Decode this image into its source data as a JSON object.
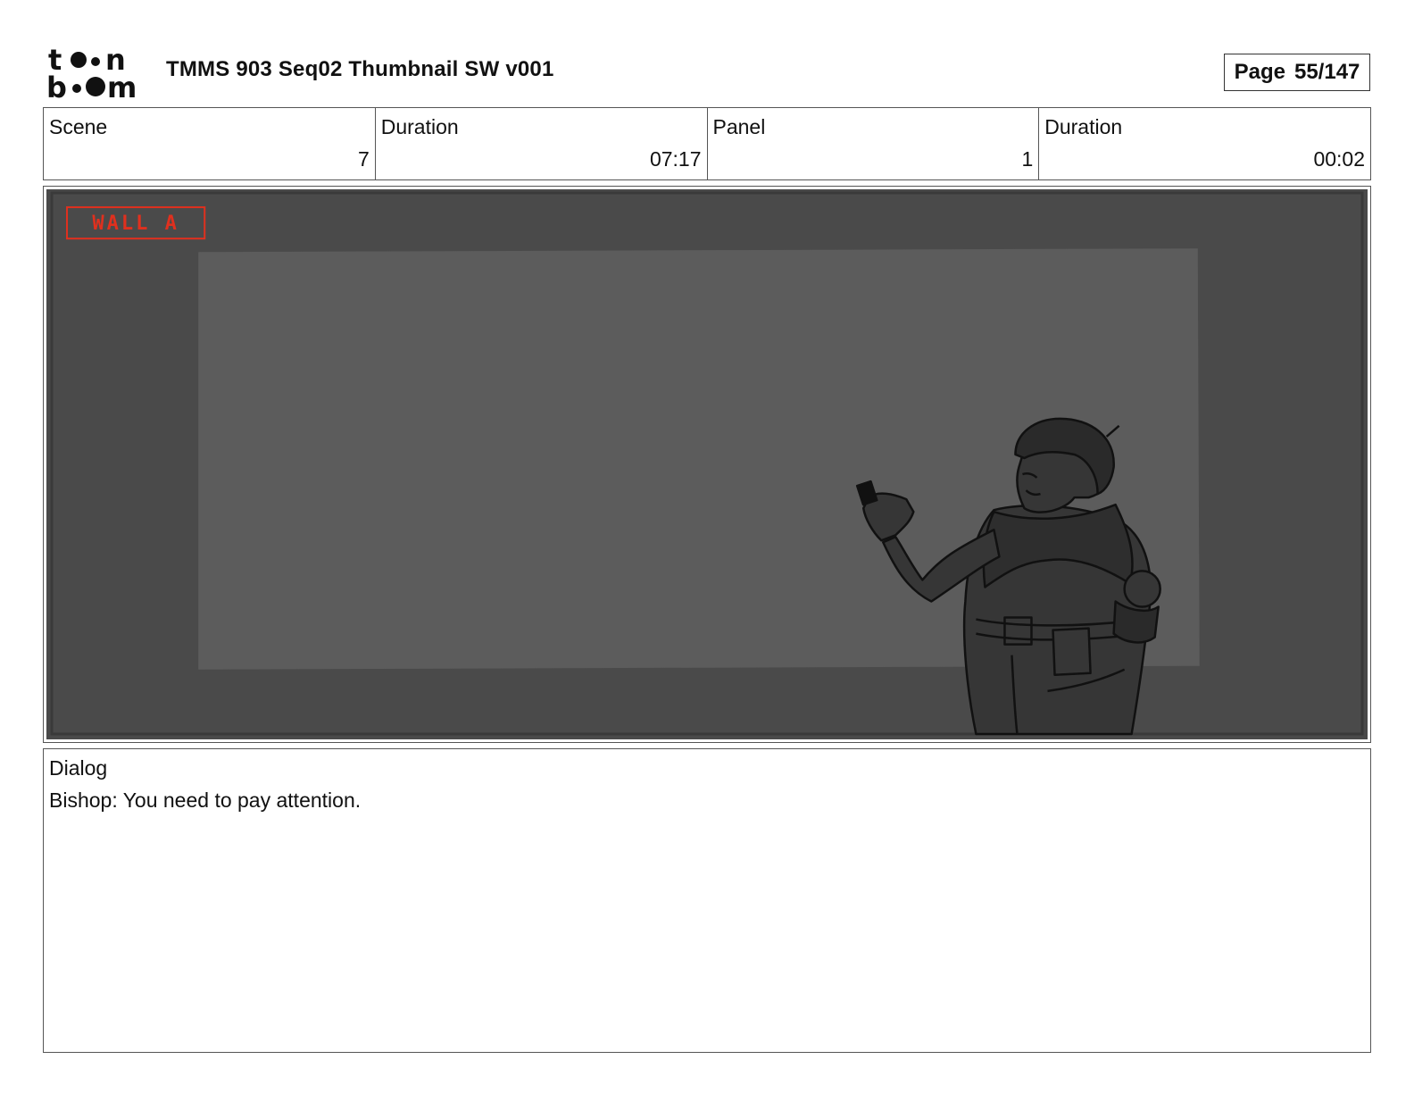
{
  "header": {
    "logo_name": "toon boom",
    "title": "TMMS 903 Seq02 Thumbnail SW v001",
    "page_label": "Page",
    "page_number": "55/147"
  },
  "info": {
    "scene_label": "Scene",
    "scene_value": "7",
    "scene_duration_label": "Duration",
    "scene_duration_value": "07:17",
    "panel_label": "Panel",
    "panel_value": "1",
    "panel_duration_label": "Duration",
    "panel_duration_value": "00:02"
  },
  "panel": {
    "wall_tag": "WALL A",
    "tag_color": "#e0301e",
    "background_color": "#4a4a4a",
    "screen_color": "#5c5c5c",
    "figure_color": "#363636"
  },
  "dialog": {
    "label": "Dialog",
    "text": "Bishop: You need to pay attention."
  }
}
